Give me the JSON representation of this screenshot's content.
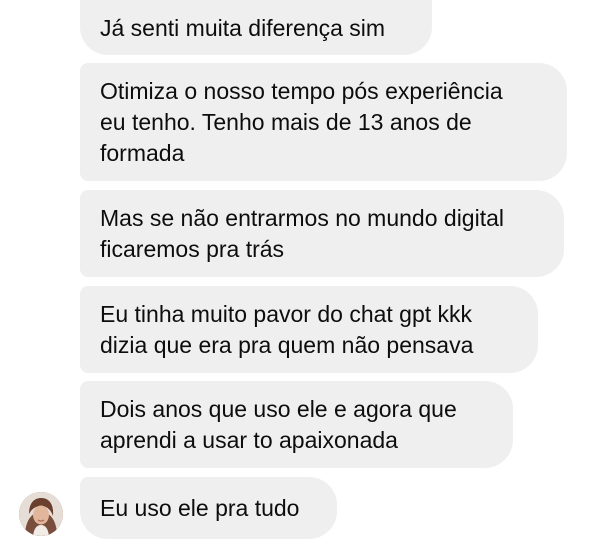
{
  "messages": [
    {
      "text": "Já senti muita diferença sim"
    },
    {
      "text": "Otimiza o nosso tempo pós experiência\neu tenho. Tenho mais de 13 anos de\nformada"
    },
    {
      "text": "Mas se não entrarmos no mundo digital\nficaremos pra trás"
    },
    {
      "text": "Eu tinha muito pavor do chat gpt kkk\ndizia que era pra quem não pensava"
    },
    {
      "text": "Dois anos que uso ele e agora que\naprendi a usar to apaixonada"
    },
    {
      "text": "Eu uso ele pra tudo"
    }
  ],
  "avatar": {
    "icon": "profile-photo"
  },
  "colors": {
    "bubble_background": "#efefef",
    "text": "#0d0d0d",
    "page_background": "#ffffff"
  }
}
